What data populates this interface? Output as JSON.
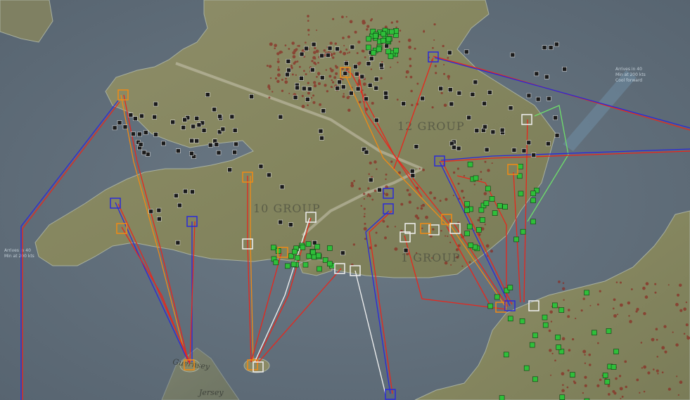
{
  "map": {
    "group_labels": [
      {
        "key": "g12",
        "text": "12 GROUP"
      },
      {
        "key": "g10",
        "text": "10 GROUP"
      },
      {
        "key": "g11",
        "text": "1 GROUP"
      }
    ],
    "place_labels": [
      {
        "key": "guernsey",
        "text": "Guernsey"
      },
      {
        "key": "jersey",
        "text": "Jersey"
      }
    ],
    "sea_notes": [
      {
        "key": "note_west",
        "lines": [
          "Arrives in 40",
          "Min at 200 kts"
        ]
      },
      {
        "key": "note_east",
        "lines": [
          "Arrives in 40",
          "Min at 200 kts",
          "Cool forward"
        ]
      }
    ],
    "colors": {
      "sea": "#5f6e7c",
      "land": "#8a8a66",
      "route_red": "#e8261c",
      "route_blue": "#2a2ad8",
      "route_orange": "#f08a14",
      "route_white": "#f4f4f4",
      "route_green": "#6fe06a",
      "unit_friendly": "#2fbf3a",
      "unit_neutral": "#1a1a1a",
      "marker_orange": "#f08a14",
      "marker_blue": "#2a2ad8",
      "marker_white": "#f0f0f0",
      "damage": "#8a2a22"
    }
  }
}
